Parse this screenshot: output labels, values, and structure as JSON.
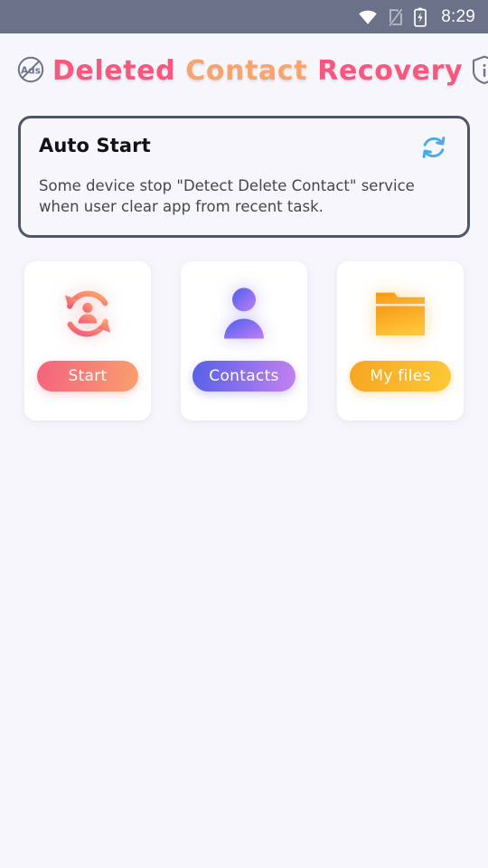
{
  "status_bar": {
    "time": "8:29",
    "icons": [
      "wifi-icon",
      "no-sim-icon",
      "battery-charging-icon"
    ],
    "background_color": "#6b7189"
  },
  "appbar": {
    "left_icon": "no-ads-icon",
    "left_icon_label": "Ads",
    "right_icon": "shield-info-icon",
    "title_parts": [
      {
        "text": "Deleted ",
        "color": "#f8577e"
      },
      {
        "text": "Contact ",
        "color": "#f9a46d"
      },
      {
        "text": "Recovery",
        "color": "#f8577e"
      }
    ],
    "title_full": "Deleted Contact Recovery"
  },
  "autostart_card": {
    "title": "Auto Start",
    "description": "Some device stop \"Detect Delete Contact\" service when user clear app from recent task.",
    "refresh_icon": "refresh-circle-icon",
    "refresh_icon_color": "#4aaaf0",
    "border_color": "#4e5668"
  },
  "action_cards": [
    {
      "id": "start",
      "icon": "contact-recovery-rotate-icon",
      "button_label": "Start",
      "gradient_from": "#f4627f",
      "gradient_to": "#f8a06d"
    },
    {
      "id": "contacts",
      "icon": "person-icon",
      "button_label": "Contacts",
      "gradient_from": "#5560e8",
      "gradient_to": "#c481f0"
    },
    {
      "id": "my-files",
      "icon": "folder-icon",
      "button_label": "My files",
      "gradient_from": "#f7a520",
      "gradient_to": "#fdc936"
    }
  ],
  "page": {
    "background_color": "#f7f6fc"
  }
}
